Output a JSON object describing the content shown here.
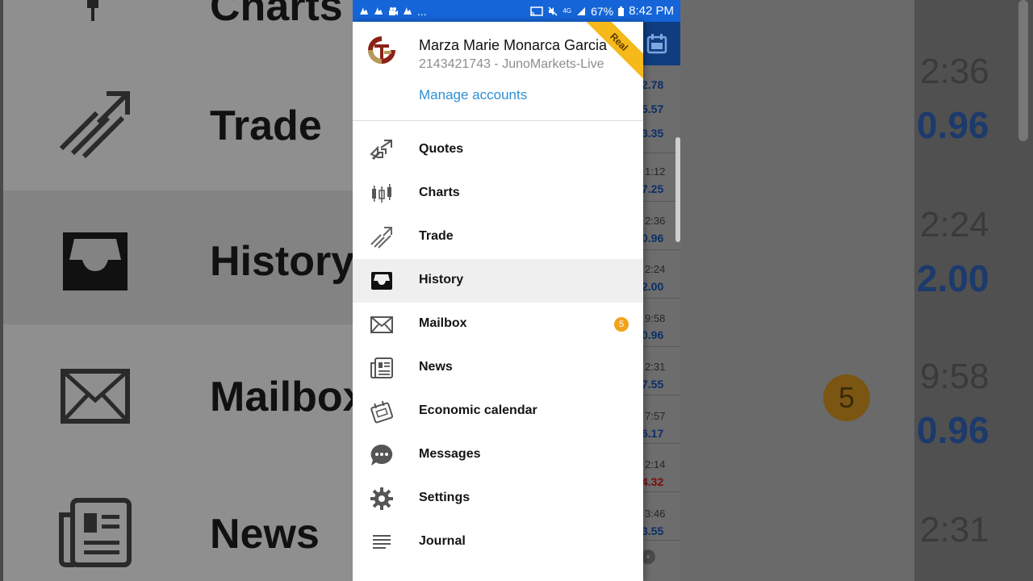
{
  "status_bar": {
    "notifications_more": "...",
    "battery": "67%",
    "clock": "8:42 PM",
    "network": "4G"
  },
  "account": {
    "name": "Marza Marie Monarca Garcia",
    "login": "2143421743 - JunoMarkets-Live",
    "manage_label": "Manage accounts",
    "ribbon": "Real"
  },
  "menu": [
    {
      "label": "Quotes",
      "icon": "quotes-icon",
      "active": false
    },
    {
      "label": "Charts",
      "icon": "candlestick-icon",
      "active": false
    },
    {
      "label": "Trade",
      "icon": "trade-icon",
      "active": false
    },
    {
      "label": "History",
      "icon": "inbox-icon",
      "active": true
    },
    {
      "label": "Mailbox",
      "icon": "envelope-icon",
      "active": false,
      "badge": "5"
    },
    {
      "label": "News",
      "icon": "newspaper-icon",
      "active": false
    },
    {
      "label": "Economic calendar",
      "icon": "calendar-icon",
      "active": false
    },
    {
      "label": "Messages",
      "icon": "chat-icon",
      "active": false
    },
    {
      "label": "Settings",
      "icon": "gear-icon",
      "active": false
    },
    {
      "label": "Journal",
      "icon": "list-icon",
      "active": false
    }
  ],
  "app_peek": {
    "top_prices": [
      "2.78",
      "5.57",
      "3.35"
    ],
    "rows": [
      {
        "time": "1:12",
        "price": "7.25"
      },
      {
        "time": "2:36",
        "price": "0.96"
      },
      {
        "time": "2:24",
        "price": "2.00"
      },
      {
        "time": "9:58",
        "price": "0.96"
      },
      {
        "time": "2:31",
        "price": "7.55"
      },
      {
        "time": "7:57",
        "price": "6.17"
      },
      {
        "time": "2:14",
        "price": "4.32",
        "negative": true
      },
      {
        "time": "3:46",
        "price": "3.55"
      }
    ]
  },
  "background": {
    "labels": [
      "Trade",
      "History",
      "Mailbox",
      "News"
    ],
    "times": [
      "2:36",
      "2:24",
      "9:58",
      "2:31"
    ],
    "prices": [
      "0.96",
      "2.00",
      "0.96"
    ],
    "badge": "5"
  },
  "colors": {
    "status_bar": "#1565d8",
    "link": "#2e8fd6",
    "badge": "#f3a31b",
    "ribbon": "#f5b91a"
  }
}
